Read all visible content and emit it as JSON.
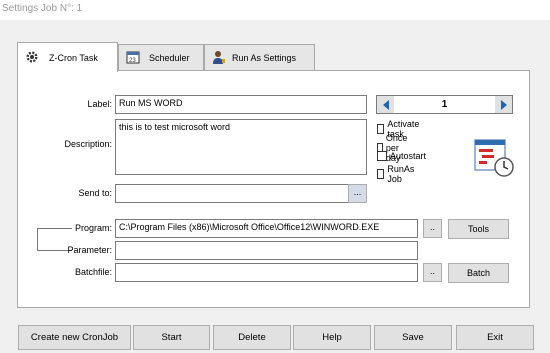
{
  "window": {
    "title": "Settings Job N°: 1"
  },
  "tabs": [
    {
      "label": "Z-Cron Task",
      "icon": "gear-icon"
    },
    {
      "label": "Scheduler",
      "icon": "calendar-icon"
    },
    {
      "label": "Run As Settings",
      "icon": "user-icon"
    }
  ],
  "form": {
    "label_caption": "Label:",
    "label_value": "Run MS WORD",
    "description_caption": "Description:",
    "description_value": "this is to test microsoft word",
    "sendto_caption": "Send to:",
    "sendto_value": "",
    "sendto_browse": "...",
    "program_caption": "Program:",
    "program_value": "C:\\Program Files (x86)\\Microsoft Office\\Office12\\WINWORD.EXE",
    "program_browse": "..",
    "parameter_caption": "Parameter:",
    "parameter_value": "",
    "batchfile_caption": "Batchfile:",
    "batchfile_value": "",
    "batchfile_browse": "..",
    "tools_label": "Tools",
    "batch_label": "Batch"
  },
  "spinner": {
    "value": "1"
  },
  "checkboxes": [
    {
      "label": "Activate task",
      "checked": false
    },
    {
      "label": "Once per day",
      "checked": false
    },
    {
      "label": "Autostart",
      "checked": false
    },
    {
      "label": "RunAs Job",
      "checked": false
    }
  ],
  "bottom_buttons": [
    "Create new CronJob",
    "Start",
    "Delete",
    "Help",
    "Save",
    "Exit"
  ],
  "colors": {
    "window_bg": "#f0f0f0",
    "spinner_arrow": "#1a66b3",
    "accent_red": "#d22b2b"
  }
}
